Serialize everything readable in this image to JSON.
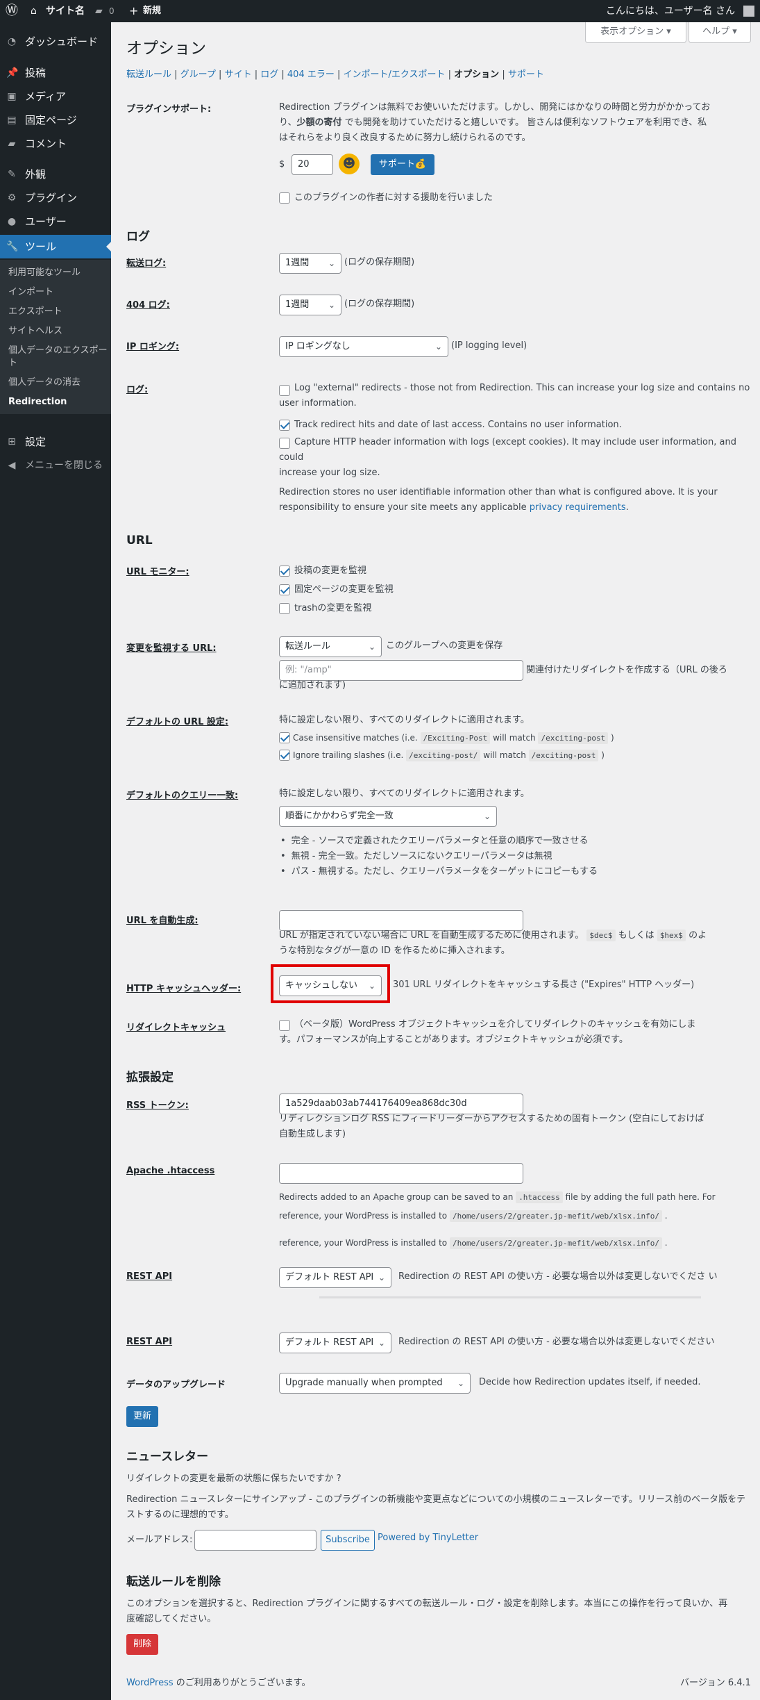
{
  "adminbar": {
    "site_name": "サイト名",
    "comments_count": "0",
    "new_label": "新規",
    "greeting": "こんにちは、ユーザー名 さん"
  },
  "menu": {
    "items": [
      "ダッシュボード",
      "投稿",
      "メディア",
      "固定ページ",
      "コメント",
      "外観",
      "プラグイン",
      "ユーザー",
      "ツール",
      "設定",
      "メニューを閉じる"
    ],
    "submenu": [
      "利用可能なツール",
      "インポート",
      "エクスポート",
      "サイトヘルス",
      "個人データのエクスポート",
      "個人データの消去",
      "Redirection"
    ]
  },
  "screen_options": {
    "display": "表示オプション ▾",
    "help": "ヘルプ ▾"
  },
  "page_title": "オプション",
  "subnav": [
    "転送ルール",
    "グループ",
    "サイト",
    "ログ",
    "404 エラー",
    "インポート/エクスポート",
    "オプション",
    "サポート"
  ],
  "support": {
    "label": "プラグインサポート:",
    "text1": "Redirection プラグインは無料でお使いいただけます。しかし、開発にはかなりの時間と労力がかかってお",
    "text2_pre": "り、",
    "text2_bold": "少額の寄付",
    "text2_post": " でも開発を助けていただけると嬉しいです。 皆さんは便利なソフトウェアを利用でき、私",
    "text3": "はそれらをより良く改良するために努力し続けられるのです。",
    "currency": "$",
    "amount": "20",
    "button": "サポート💰",
    "checkbox": "このプラグインの作者に対する援助を行いました"
  },
  "logs": {
    "heading": "ログ",
    "redirect_label": "転送ログ:",
    "redirect_value": "1週間",
    "redirect_note": "(ログの保存期間)",
    "e404_label": "404 ログ:",
    "e404_value": "1週間",
    "e404_note": "(ログの保存期間)",
    "ip_label": "IP ロギング:",
    "ip_value": "IP ロギングなし",
    "ip_note": "(IP logging level)",
    "log_label": "ログ:",
    "opt1a": "Log \"external\" redirects - those not from Redirection. This can increase your log size and contains no",
    "opt1b": "user information.",
    "opt2": "Track redirect hits and date of last access. Contains no user information.",
    "opt3a": "Capture HTTP header information with logs (except cookies). It may include user information, and could",
    "opt3b": "increase your log size.",
    "privacy1": "Redirection stores no user identifiable information other than what is configured above. It is your",
    "privacy2_pre": "responsibility to ensure your site meets any applicable ",
    "privacy_link": "privacy requirements",
    "privacy2_post": "."
  },
  "url": {
    "heading": "URL",
    "monitor_label": "URL モニター:",
    "mon1": "投稿の変更を監視",
    "mon2": "固定ページの変更を監視",
    "mon3": "trashの変更を監視",
    "watch_label": "変更を監視する URL:",
    "watch_value": "転送ルール",
    "watch_note": "このグループへの変更を保存",
    "amp_placeholder": "例: \"/amp\"",
    "amp_note1": "関連付けたリダイレクトを作成する（URL の後ろ",
    "amp_note2": "に追加されます)",
    "default_url_label": "デフォルトの URL 設定:",
    "default_url_text": "特に設定しない限り、すべてのリダイレクトに適用されます。",
    "case_pre": "Case insensitive matches (i.e. ",
    "case_code1": "/Exciting-Post",
    "case_mid": " will match ",
    "case_code2": "/exciting-post",
    "case_post": " )",
    "trail_pre": "Ignore trailing slashes (i.e. ",
    "trail_code1": "/exciting-post/",
    "trail_mid": " will match ",
    "trail_code2": "/exciting-post",
    "trail_post": " )",
    "query_label": "デフォルトのクエリー一致:",
    "query_text": "特に設定しない限り、すべてのリダイレクトに適用されます。",
    "query_value": "順番にかかわらず完全一致",
    "query_bullets": [
      "完全 - ソースで定義されたクエリーパラメータと任意の順序で一致させる",
      "無視 - 完全一致。ただしソースにないクエリーパラメータは無視",
      "パス - 無視する。ただし、クエリーパラメータをターゲットにコピーもする"
    ],
    "auto_label": "URL を自動生成:",
    "auto_note_pre": "URL が指定されていない場合に URL を自動生成するために使用されます。 ",
    "auto_code1": "$dec$",
    "auto_mid": " もしくは ",
    "auto_code2": "$hex$",
    "auto_post": " のよ",
    "auto_note2": "うな特別なタグが一意の ID を作るために挿入されます。",
    "cache_label": "HTTP キャッシュヘッダー:",
    "cache_value": "キャッシュしない",
    "cache_note": "301 URL リダイレクトをキャッシュする長さ (\"Expires\" HTTP ヘッダー)",
    "rcache_label": "リダイレクトキャッシュ",
    "rcache_note1": "（ベータ版）WordPress オブジェクトキャッシュを介してリダイレクトのキャッシュを有効にしま",
    "rcache_note2": "す。パフォーマンスが向上することがあります。オブジェクトキャッシュが必須です。"
  },
  "advanced": {
    "heading": "拡張設定",
    "rss_label": "RSS トークン:",
    "rss_value": "1a529daab03ab744176409ea868dc30d",
    "rss_note1": "リディレクションログ RSS にフィードリーダーからアクセスするための固有トークン (空白にしておけば",
    "rss_note2": "自動生成します)",
    "apache_label": "Apache .htaccess",
    "apache_note1_pre": "Redirects added to an Apache group can be saved to an ",
    "apache_code": ".htaccess",
    "apache_note1_post": " file by adding the full path here. For",
    "apache_note2_pre": "reference, your WordPress is installed to ",
    "apache_path": "/home/users/2/greater.jp-mefit/web/xlsx.info/",
    "apache_note2_post": " .",
    "apache_note3_pre": "reference, your WordPress is installed to ",
    "rest_label": "REST API",
    "rest_value": "デフォルト REST API",
    "rest_note_a": "Redirection の REST API の使い方 - 必要な場合以外は変更しないでくださ い",
    "rest_note_b": "Redirection の REST API の使い方 - 必要な場合以外は変更しないでください",
    "upgrade_label": "データのアップグレード",
    "upgrade_value": "Upgrade manually when prompted",
    "upgrade_note": "Decide how Redirection updates itself, if needed.",
    "update_button": "更新"
  },
  "newsletter": {
    "heading": "ニュースレター",
    "q": "リダイレクトの変更を最新の状態に保ちたいですか ?",
    "desc1": "Redirection ニュースレターにサインアップ - このプラグインの新機能や変更点などについての小規模のニュースレターです。リリース前のベータ版をテ",
    "desc2": "ストするのに理想的です。",
    "email_label": "メールアドレス:",
    "subscribe": "Subscribe",
    "powered": "Powered by TinyLetter"
  },
  "delete": {
    "heading": "転送ルールを削除",
    "desc1": "このオプションを選択すると、Redirection プラグインに関するすべての転送ルール・ログ・設定を削除します。本当にこの操作を行って良いか、再",
    "desc2": "度確認してください。",
    "button": "削除"
  },
  "footer": {
    "left_link": "WordPress",
    "left_text": " のご利用ありがとうございます。",
    "version": "バージョン 6.4.1"
  },
  "colors": {
    "accent": "#2271b1",
    "highlight_box": "#e00000"
  }
}
